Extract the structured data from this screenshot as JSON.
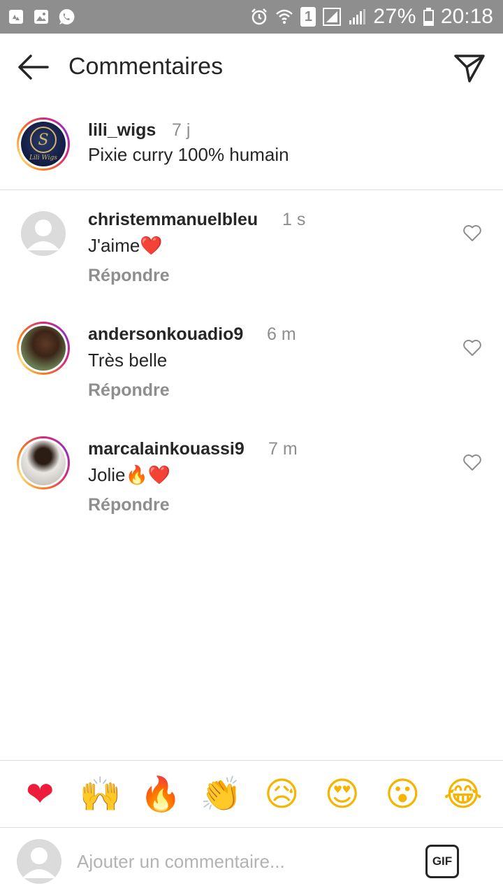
{
  "status_bar": {
    "battery_percent": "27%",
    "time": "20:18",
    "sim_label": "1",
    "icons": [
      "recycle-icon",
      "image-icon",
      "whatsapp-icon",
      "alarm-icon",
      "wifi-icon",
      "sim-icon",
      "signal-icon",
      "signal-icon",
      "battery-icon"
    ]
  },
  "header": {
    "title": "Commentaires",
    "back_icon": "arrow-left-icon",
    "send_icon": "paper-plane-icon"
  },
  "caption": {
    "username": "lili_wigs",
    "time": "7 j",
    "text": "Pixie curry 100% humain"
  },
  "comments": [
    {
      "username": "christemmanuelbleu",
      "time": "1 s",
      "text": "J'aime❤️",
      "reply_label": "Répondre"
    },
    {
      "username": "andersonkouadio9",
      "time": "6 m",
      "text": "Très belle",
      "reply_label": "Répondre"
    },
    {
      "username": "marcalainkouassi9",
      "time": "7 m",
      "text": "Jolie🔥❤️",
      "reply_label": "Répondre"
    }
  ],
  "reactions": [
    "❤",
    "🙌",
    "🔥",
    "👏",
    "😥",
    "😍",
    "😮",
    "😂"
  ],
  "composer": {
    "placeholder": "Ajouter un commentaire...",
    "gif_label": "GIF"
  },
  "colors": {
    "text": "#262626",
    "muted": "#8e8e8e",
    "divider": "#dbdbdb",
    "status_bar": "#8e8e8e",
    "heart_red": "#ed1c3a"
  }
}
